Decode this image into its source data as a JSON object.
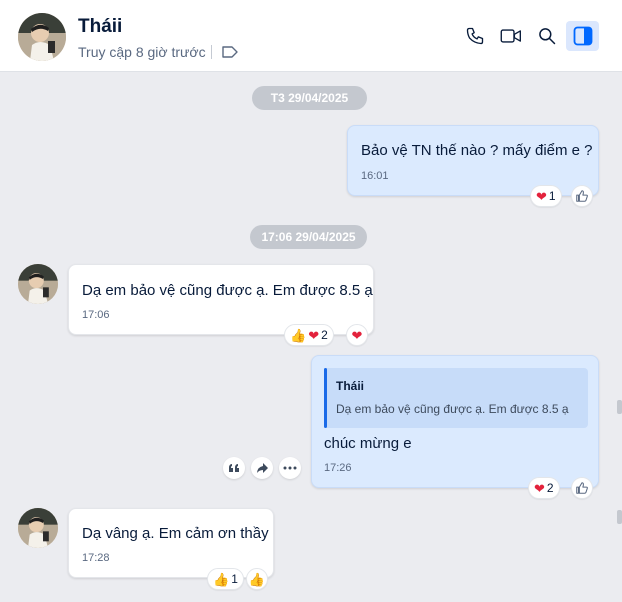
{
  "header": {
    "contact_name": "Tháii",
    "last_seen": "Truy cập 8 giờ trước",
    "icons": [
      "phone-icon",
      "video-call-icon",
      "search-icon",
      "side-panel-icon"
    ]
  },
  "conversation": {
    "date_dividers": [
      "T3 29/04/2025",
      "17:06 29/04/2025"
    ],
    "messages": [
      {
        "sender": "me",
        "text": "Bảo vệ TN thế nào ? mấy điểm e ?",
        "time": "16:01",
        "reactions": {
          "emoji": "❤️",
          "count": "1"
        }
      },
      {
        "sender": "them",
        "text": "Dạ em bảo vệ cũng được ạ. Em được 8.5 ạ",
        "time": "17:06",
        "reactions": {
          "emoji": "👍❤️",
          "count": "2",
          "my_reaction": "❤️"
        }
      },
      {
        "sender": "me",
        "quote": {
          "author": "Tháii",
          "text": "Dạ em bảo vệ cũng được ạ. Em được 8.5 ạ"
        },
        "text": "chúc mừng e",
        "time": "17:26",
        "reactions": {
          "emoji": "❤️",
          "count": "2"
        }
      },
      {
        "sender": "them",
        "text": "Dạ vâng ạ. Em cảm ơn thầy",
        "time": "17:28",
        "reactions": {
          "emoji": "👍",
          "count": "1",
          "my_reaction": "👍"
        }
      }
    ],
    "hover_actions": [
      "quote-icon",
      "forward-icon",
      "more-icon"
    ]
  },
  "colors": {
    "accent": "#1a6ae8",
    "my_bubble": "#dbeafe",
    "their_bubble": "#ffffff",
    "background": "#ebecf0",
    "heart": "#e3223c",
    "thumb": "#f2b631"
  }
}
